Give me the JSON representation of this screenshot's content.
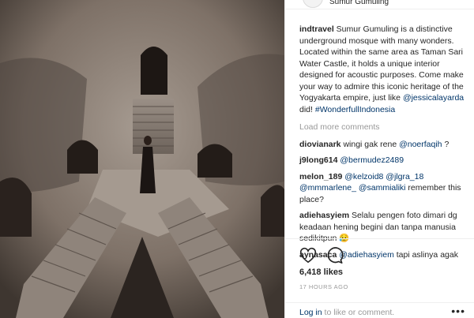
{
  "post": {
    "location": "Sumur Gumuling",
    "caption": {
      "username": "indtravel",
      "text": " Sumur Gumuling is a distinctive underground mosque with many wonders. Located within the same area as Taman Sari Water Castle, it holds a unique interior designed for acoustic purposes. Come make your way to admire this iconic heritage of the Yogyakarta empire, just like ",
      "mention": "@jessicalayarda",
      "text2": " did! ",
      "hashtag": "#WonderfullIndonesia"
    },
    "load_more": "Load more comments",
    "comments": [
      {
        "user": "diovianark",
        "pre": " wingi gak rene ",
        "mention": "@noerfaqih",
        "post": " ?"
      },
      {
        "user": "j9long614",
        "pre": " ",
        "mention": "@bermudez2489",
        "post": ""
      },
      {
        "user": "melon_189",
        "pre": " ",
        "mention": "@kelzoid8 @jlgra_18 @mmmarlene_ @sammialiki",
        "post": " remember this place?"
      },
      {
        "user": "adiehasyiem",
        "pre": " Selalu pengen foto dimari dg keadaan hening begini dan tanpa manusia sedikitpun ",
        "mention": "",
        "post": "😥"
      },
      {
        "user": "aynasaca",
        "pre": " ",
        "mention": "@adiehasyiem",
        "post": " tapi aslinya agak"
      }
    ],
    "likes": "6,418 likes",
    "time": "17 HOURS AGO",
    "login": {
      "link": "Log in",
      "rest": " to like or comment."
    },
    "more_dots": "•••"
  }
}
